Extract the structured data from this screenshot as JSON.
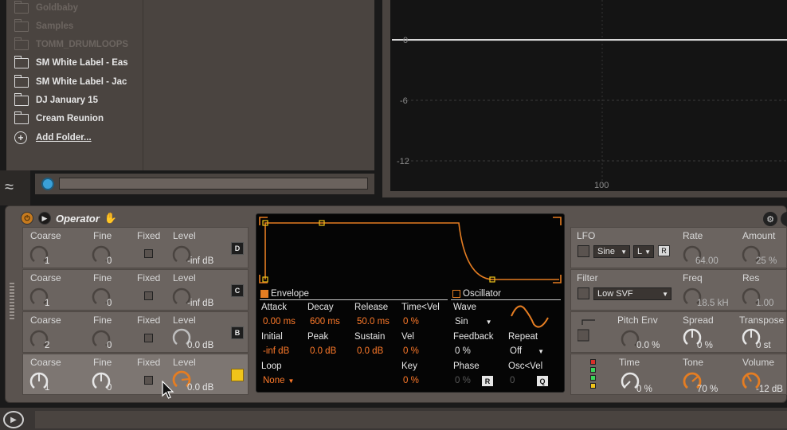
{
  "browser": {
    "items": [
      {
        "label": "Goldbaby",
        "faded": true
      },
      {
        "label": "Samples",
        "faded": true
      },
      {
        "label": "TOMM_DRUMLOOPS",
        "faded": true
      },
      {
        "label": "SM White Label - Eas",
        "faded": false
      },
      {
        "label": "SM White Label - Jac",
        "faded": false
      },
      {
        "label": "DJ January 15",
        "faded": false
      },
      {
        "label": "Cream Reunion",
        "faded": false
      }
    ],
    "add_folder": "Add Folder...",
    "add_icon": "+"
  },
  "spectrum": {
    "db_labels": [
      "0",
      "-6",
      "-12"
    ],
    "freq_label": "100"
  },
  "device": {
    "title": "Operator",
    "power_icon": "⏻",
    "play_icon": "▶",
    "hand_icon": "✋",
    "settings_icon": "⚙"
  },
  "operators": {
    "headers": {
      "coarse": "Coarse",
      "fine": "Fine",
      "fixed": "Fixed",
      "level": "Level"
    },
    "rows": [
      {
        "coarse": "1",
        "fine": "0",
        "level": "-inf dB",
        "letter": "D",
        "level_active": false
      },
      {
        "coarse": "1",
        "fine": "0",
        "level": "-inf dB",
        "letter": "C",
        "level_active": false
      },
      {
        "coarse": "2",
        "fine": "0",
        "level": "0.0 dB",
        "letter": "B",
        "level_active": false
      },
      {
        "coarse": "1",
        "fine": "0",
        "level": "0.0 dB",
        "letter": "",
        "level_active": true
      }
    ]
  },
  "display": {
    "envelope": {
      "title": "Envelope",
      "attack_label": "Attack",
      "attack": "0.00 ms",
      "decay_label": "Decay",
      "decay": "600 ms",
      "release_label": "Release",
      "release": "50.0 ms",
      "timevel_label": "Time<Vel",
      "timevel": "0 %",
      "initial_label": "Initial",
      "initial": "-inf dB",
      "peak_label": "Peak",
      "peak": "0.0 dB",
      "sustain_label": "Sustain",
      "sustain": "0.0 dB",
      "vel_label": "Vel",
      "vel": "0 %",
      "loop_label": "Loop",
      "loop": "None",
      "key_label": "Key",
      "key": "0 %"
    },
    "oscillator": {
      "title": "Oscillator",
      "wave_label": "Wave",
      "wave": "Sin",
      "feedback_label": "Feedback",
      "feedback": "0 %",
      "repeat_label": "Repeat",
      "repeat": "Off",
      "phase_label": "Phase",
      "phase": "0 %",
      "phase_btn": "R",
      "oscvel_label": "Osc<Vel",
      "oscvel": "0",
      "oscvel_btn": "Q"
    }
  },
  "right_panel": {
    "lfo": {
      "label": "LFO",
      "wave": "Sine",
      "dest": "L",
      "retrig": "R",
      "rate_label": "Rate",
      "rate": "64.00",
      "amount_label": "Amount",
      "amount": "25 %"
    },
    "filter": {
      "label": "Filter",
      "type": "Low SVF",
      "freq_label": "Freq",
      "freq": "18.5 kH",
      "res_label": "Res",
      "res": "1.00"
    },
    "pitch": {
      "label": "Pitch Env",
      "value": "0.0 %",
      "spread_label": "Spread",
      "spread": "0 %",
      "transpose_label": "Transpose",
      "transpose": "0 st"
    },
    "global": {
      "time_label": "Time",
      "time": "0 %",
      "tone_label": "Tone",
      "tone": "70 %",
      "volume_label": "Volume",
      "volume": "-12 dB"
    }
  },
  "bottom": {
    "play_icon": "▶"
  },
  "colors": {
    "accent": "#e57d22",
    "value_orange": "#ff7a2a",
    "spectrum_line": "#d8d8d8",
    "hotswap_blue": "#3aa0d8"
  }
}
